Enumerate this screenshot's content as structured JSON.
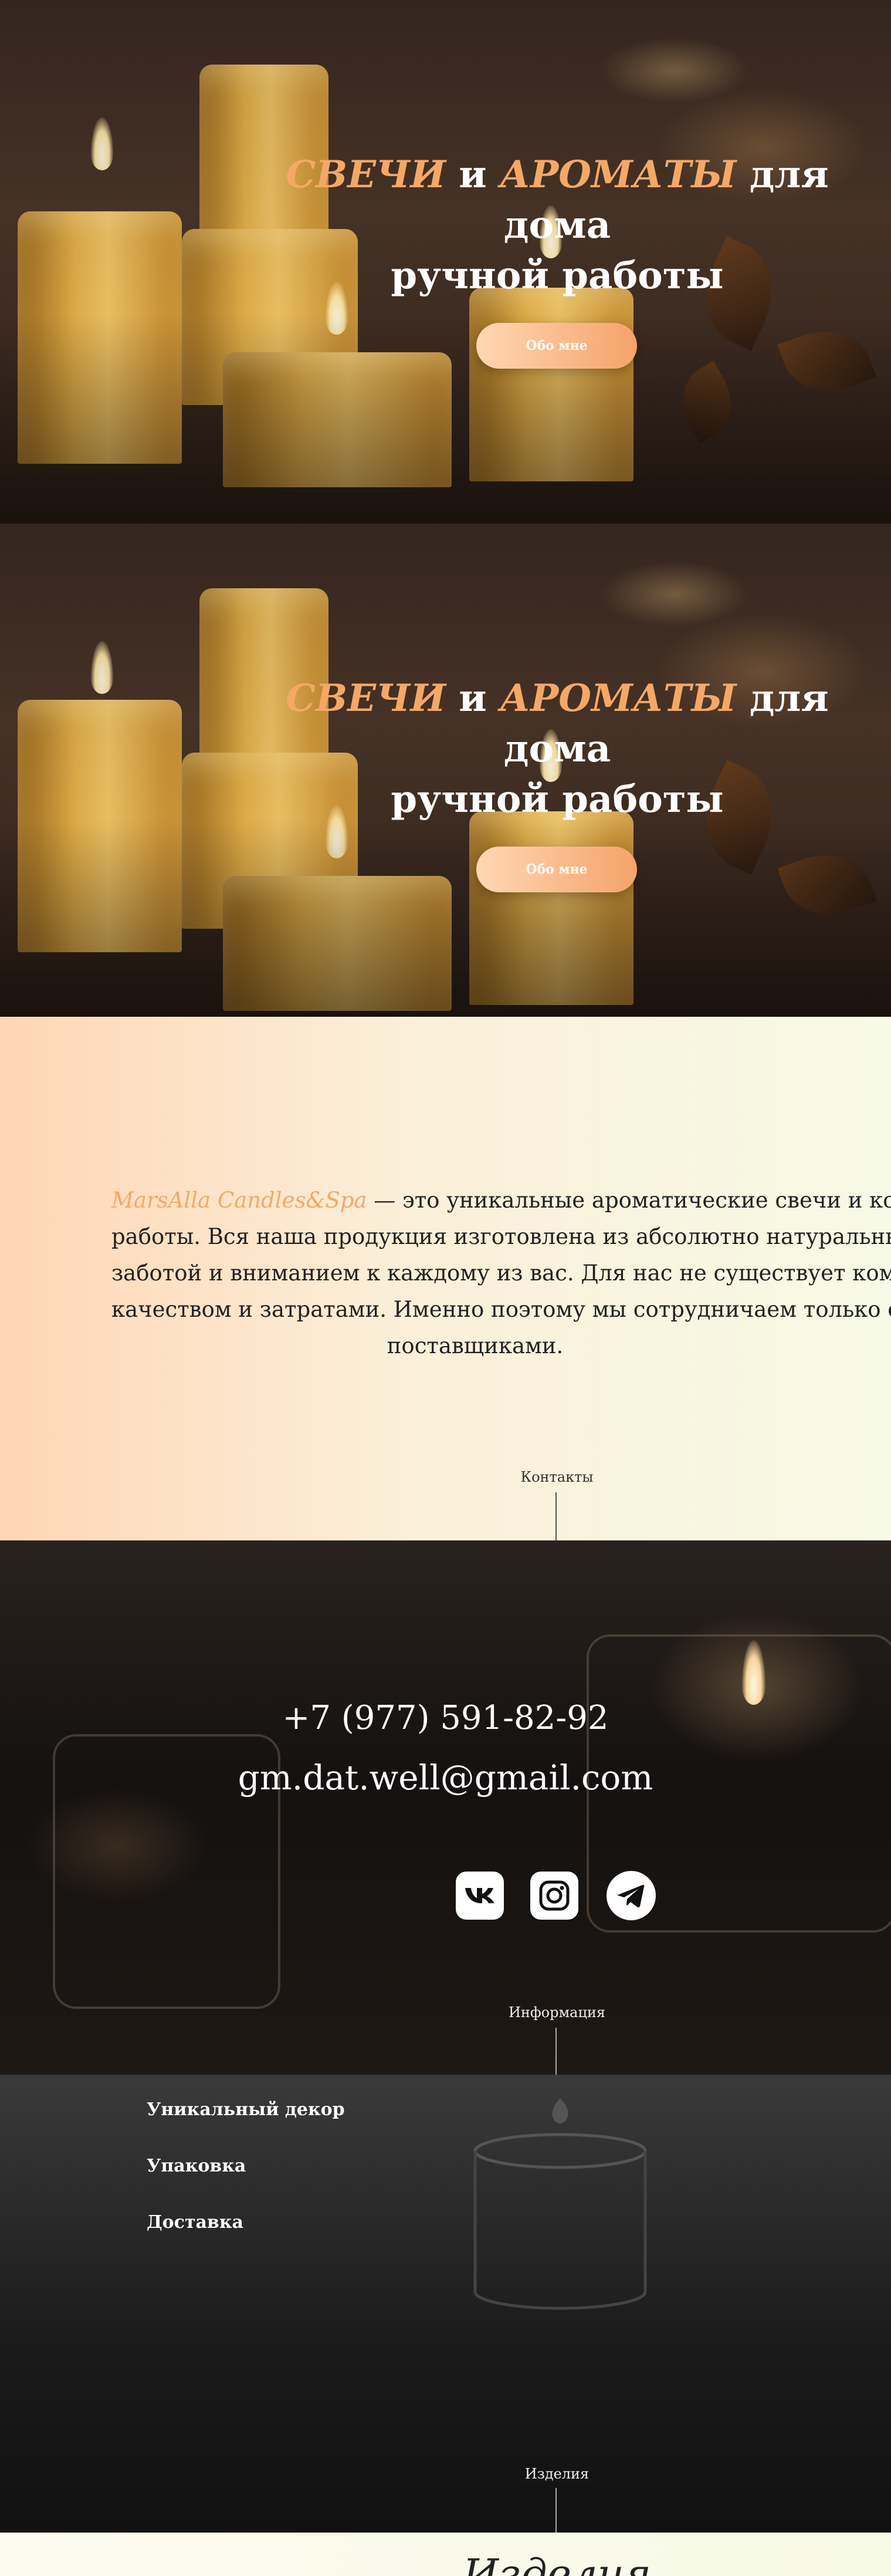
{
  "hero": {
    "title_accent_1": "СВЕЧИ",
    "title_mid": " и ",
    "title_accent_2": "АРОМАТЫ",
    "title_rest_1": " для дома",
    "title_rest_2": "ручной работы",
    "button_label": "Обо мне",
    "accent_color": "#f5a866"
  },
  "about": {
    "brand": "MarsAlla Candles&Spa",
    "line_1_rest": " — это уникальные ароматические свечи и косметик",
    "line_2": "работы. Вся наша продукция изготовлена из абсолютно натуральных компо",
    "line_3": "заботой и вниманием к каждому из вас. Для нас не существует компромисс",
    "line_4": "качеством и затратами. Именно поэтому мы сотрудничаем только с провер",
    "line_5": "поставщиками.",
    "next_label": "Контакты"
  },
  "contacts": {
    "phone": "+7 (977) 591-82-92",
    "email": "gm.dat.well@gmail.com",
    "social": [
      {
        "name": "vk-icon"
      },
      {
        "name": "instagram-icon"
      },
      {
        "name": "telegram-icon"
      }
    ],
    "next_label": "Информация"
  },
  "info": {
    "items": [
      "Уникальный декор",
      "Упаковка",
      "Доставка"
    ],
    "next_label": "Изделия"
  },
  "products": {
    "title": "Изделия"
  }
}
